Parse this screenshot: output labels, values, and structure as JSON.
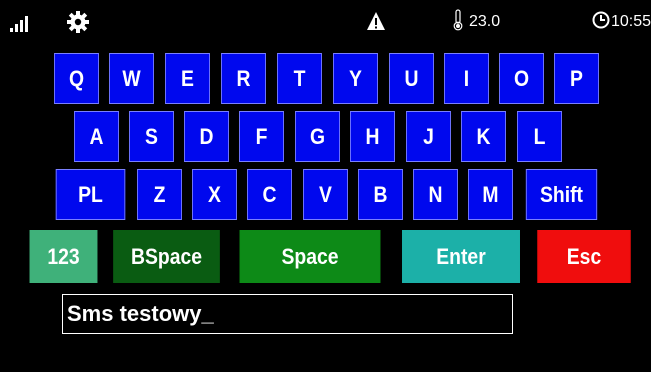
{
  "status_bar": {
    "temperature": "23.0",
    "time": "10:55"
  },
  "keyboard": {
    "row1": [
      "Q",
      "W",
      "E",
      "R",
      "T",
      "Y",
      "U",
      "I",
      "O",
      "P"
    ],
    "row2": [
      "A",
      "S",
      "D",
      "F",
      "G",
      "H",
      "J",
      "K",
      "L"
    ],
    "row3": [
      "PL",
      "Z",
      "X",
      "C",
      "V",
      "B",
      "N",
      "M",
      "Shift"
    ],
    "row4": [
      "123",
      "BSpace",
      "Space",
      "Enter",
      "Esc"
    ]
  },
  "input": {
    "value": "Sms testowy_"
  },
  "colors": {
    "key_blue": "#0008ee",
    "num_key": "#3fb17a",
    "bspace_key": "#0a5c12",
    "space_key": "#0d8a17",
    "enter_key": "#1cb0a8",
    "esc_key": "#f00d0d"
  },
  "icons": [
    "signal-icon",
    "gear-icon",
    "warning-icon",
    "thermometer-icon",
    "clock-icon"
  ]
}
